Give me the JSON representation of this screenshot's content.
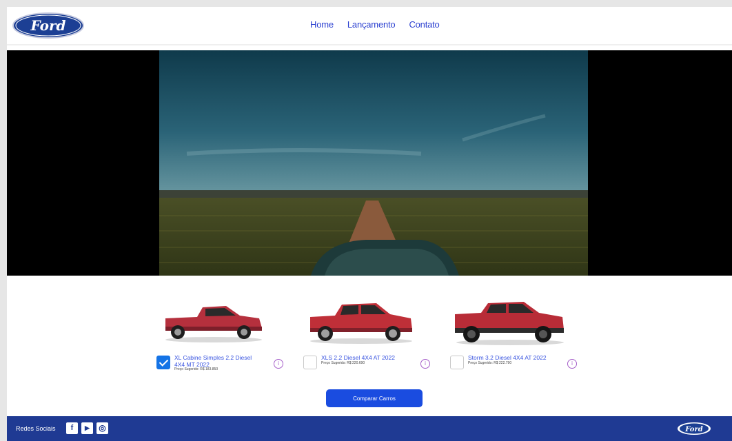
{
  "header": {
    "logo_text": "Ford",
    "nav": [
      {
        "label": "Home"
      },
      {
        "label": "Lançamento"
      },
      {
        "label": "Contato"
      }
    ]
  },
  "cars": [
    {
      "name": "XL Cabine Simples 2.2 Diesel 4X4 MT 2022",
      "price": "Preço Sugerido: R$ 183.850",
      "checked": true,
      "color": "#b5303d"
    },
    {
      "name": "XLS 2.2 Diesel 4X4 AT 2022",
      "price": "Preço Sugerido: R$ 220.690",
      "checked": false,
      "color": "#bf2f38"
    },
    {
      "name": "Storm 3.2 Diesel 4X4 AT 2022",
      "price": "Preço Sugerido: R$ 222.790",
      "checked": false,
      "color": "#b82c37"
    }
  ],
  "info_icon": "i",
  "compare_button": "Comparar Carros",
  "footer": {
    "label": "Redes Sociais",
    "social": [
      {
        "icon": "facebook-icon",
        "glyph": "f"
      },
      {
        "icon": "youtube-icon",
        "glyph": "▶"
      },
      {
        "icon": "instagram-icon",
        "glyph": "◎"
      }
    ],
    "logo_text": "Ford"
  },
  "colors": {
    "brand_blue": "#1f3a93",
    "link_blue": "#2a3fd0",
    "button_blue": "#1a4ce0",
    "info_purple": "#a55ec9"
  }
}
